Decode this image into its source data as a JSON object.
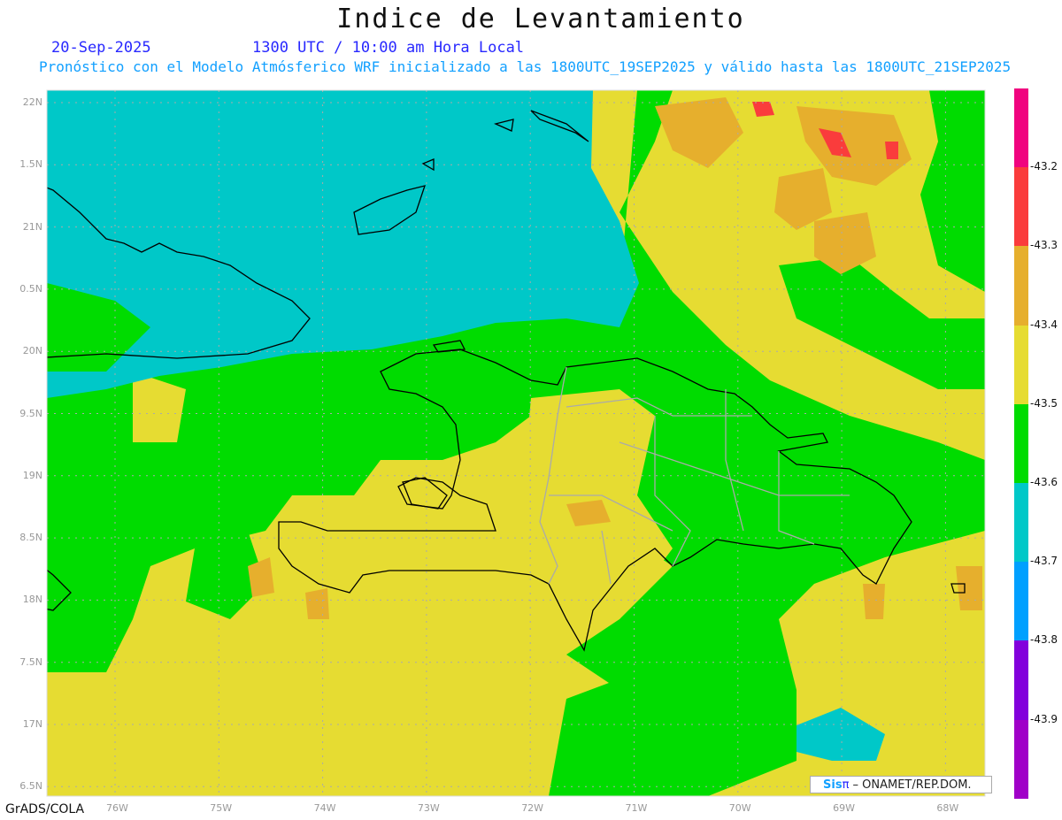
{
  "title": "Indice de Levantamiento",
  "date": "20-Sep-2025",
  "time": "1300 UTC / 10:00 am Hora Local",
  "subtitle": "Pronóstico con el Modelo Atmósferico WRF inicializado a las 1800UTC_19SEP2025 y válido hasta las  1800UTC_21SEP2025",
  "credit": "GrADS/COLA",
  "badge": {
    "logo": "Sis",
    "logo_pi": "π",
    "text": " – ONAMET/REP.DOM."
  },
  "lat_labels": [
    "22N",
    "1.5N",
    "21N",
    "0.5N",
    "20N",
    "9.5N",
    "19N",
    "8.5N",
    "18N",
    "7.5N",
    "17N",
    "6.5N"
  ],
  "lon_labels": [
    "76W",
    "75W",
    "74W",
    "73W",
    "72W",
    "71W",
    "70W",
    "69W",
    "68W"
  ],
  "colorbar": {
    "colors": [
      "#f0047f",
      "#fa3c3c",
      "#e6af2d",
      "#e6dc32",
      "#00dc00",
      "#00c8c8",
      "#00a0ff",
      "#8200dc",
      "#a000c8"
    ],
    "labels": [
      "-43.2",
      "-43.3",
      "-43.4",
      "-43.5",
      "-43.6",
      "-43.7",
      "-43.8",
      "-43.9"
    ]
  }
}
